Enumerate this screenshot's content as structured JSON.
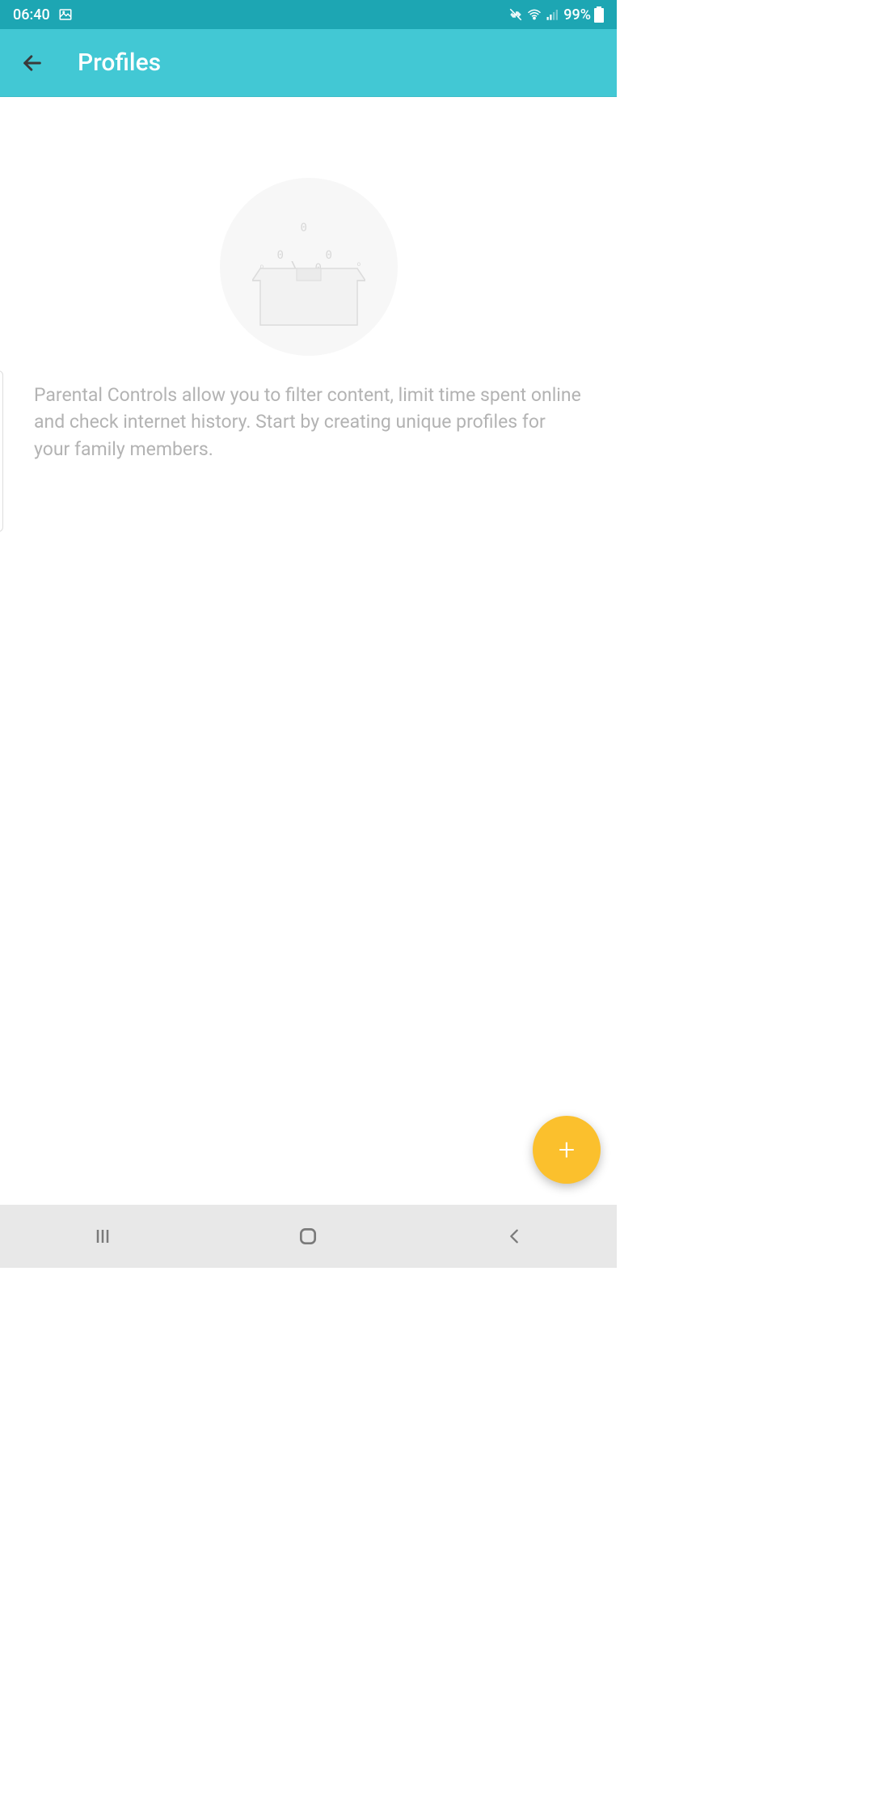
{
  "status_bar": {
    "time": "06:40",
    "battery": "99%"
  },
  "app_bar": {
    "title": "Profiles"
  },
  "content": {
    "description": "Parental Controls allow you to filter content, limit time spent online and check internet history. Start by creating unique profiles for your family members."
  },
  "fab": {
    "label": "+"
  }
}
